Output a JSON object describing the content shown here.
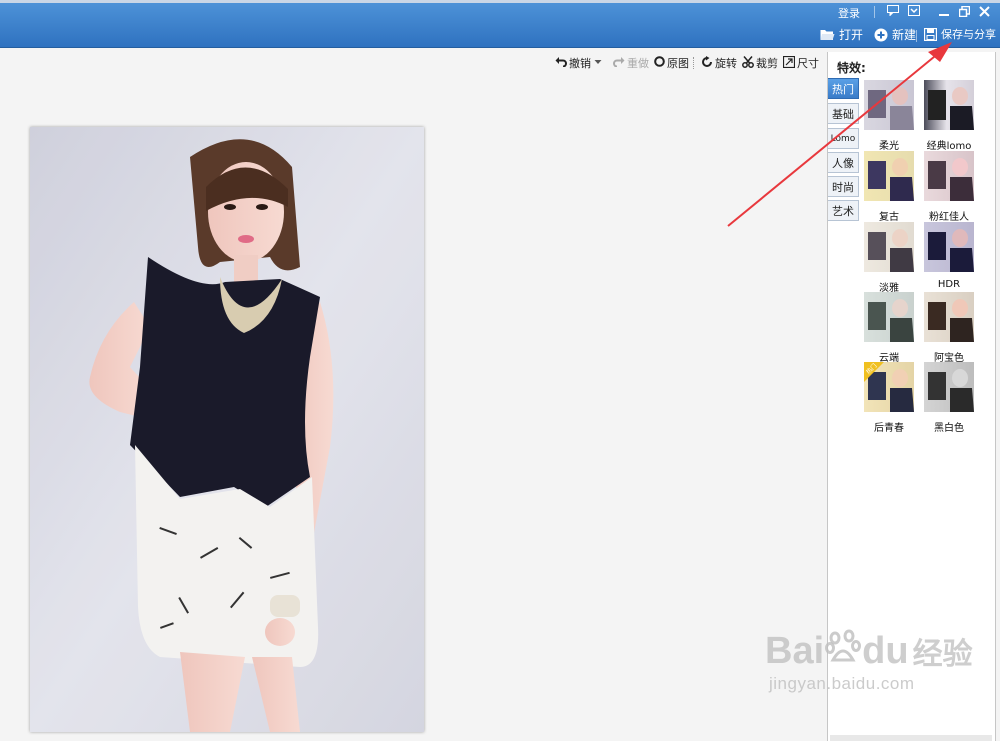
{
  "titlebar": {
    "login": "登录",
    "buttons": {
      "open": "打开",
      "new": "新建",
      "save_share": "保存与分享"
    }
  },
  "edit_toolbar": {
    "undo": "撤销",
    "redo": "重做",
    "original": "原图",
    "rotate": "旋转",
    "crop": "裁剪",
    "size": "尺寸"
  },
  "effects_panel": {
    "title": "特效:",
    "tabs": [
      "热门",
      "基础",
      "Lomo",
      "人像",
      "时尚",
      "艺术"
    ],
    "active_tab": "热门",
    "effects": [
      "柔光",
      "经典lomo",
      "复古",
      "粉红佳人",
      "淡雅",
      "HDR",
      "云端",
      "阿宝色",
      "后青春",
      "黑白色"
    ],
    "badge": "热门"
  },
  "watermark": {
    "brand": "Bai",
    "brand2": "du",
    "suffix": "经验",
    "url": "jingyan.baidu.com"
  },
  "colors": {
    "titlebar": "#3a7fcc",
    "arrow": "#e8383d",
    "active_tab": "#4a8fd9"
  }
}
